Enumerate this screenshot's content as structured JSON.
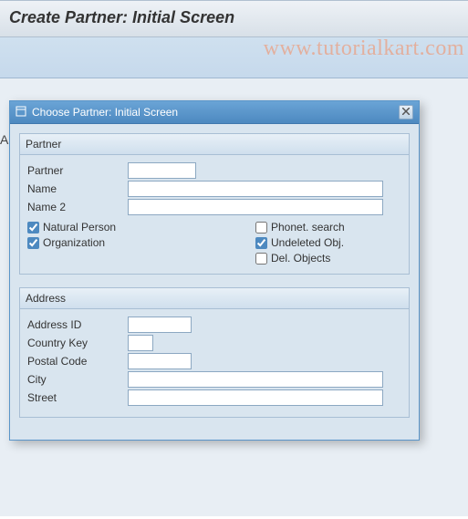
{
  "watermark": "www.tutorialkart.com",
  "page_title": "Create Partner: Initial Screen",
  "dialog": {
    "title": "Choose Partner: Initial Screen"
  },
  "partner_group": {
    "header": "Partner",
    "partner_label": "Partner",
    "partner_value": "",
    "name_label": "Name",
    "name_value": "",
    "name2_label": "Name 2",
    "name2_value": "",
    "natural_person_label": "Natural Person",
    "organization_label": "Organization",
    "phonet_search_label": "Phonet. search",
    "undeleted_obj_label": "Undeleted Obj.",
    "del_objects_label": "Del. Objects",
    "natural_person_checked": true,
    "organization_checked": true,
    "phonet_search_checked": false,
    "undeleted_obj_checked": true,
    "del_objects_checked": false
  },
  "address_group": {
    "header": "Address",
    "address_id_label": "Address ID",
    "address_id_value": "",
    "country_key_label": "Country Key",
    "country_key_value": "",
    "postal_code_label": "Postal Code",
    "postal_code_value": "",
    "city_label": "City",
    "city_value": "",
    "street_label": "Street",
    "street_value": ""
  }
}
